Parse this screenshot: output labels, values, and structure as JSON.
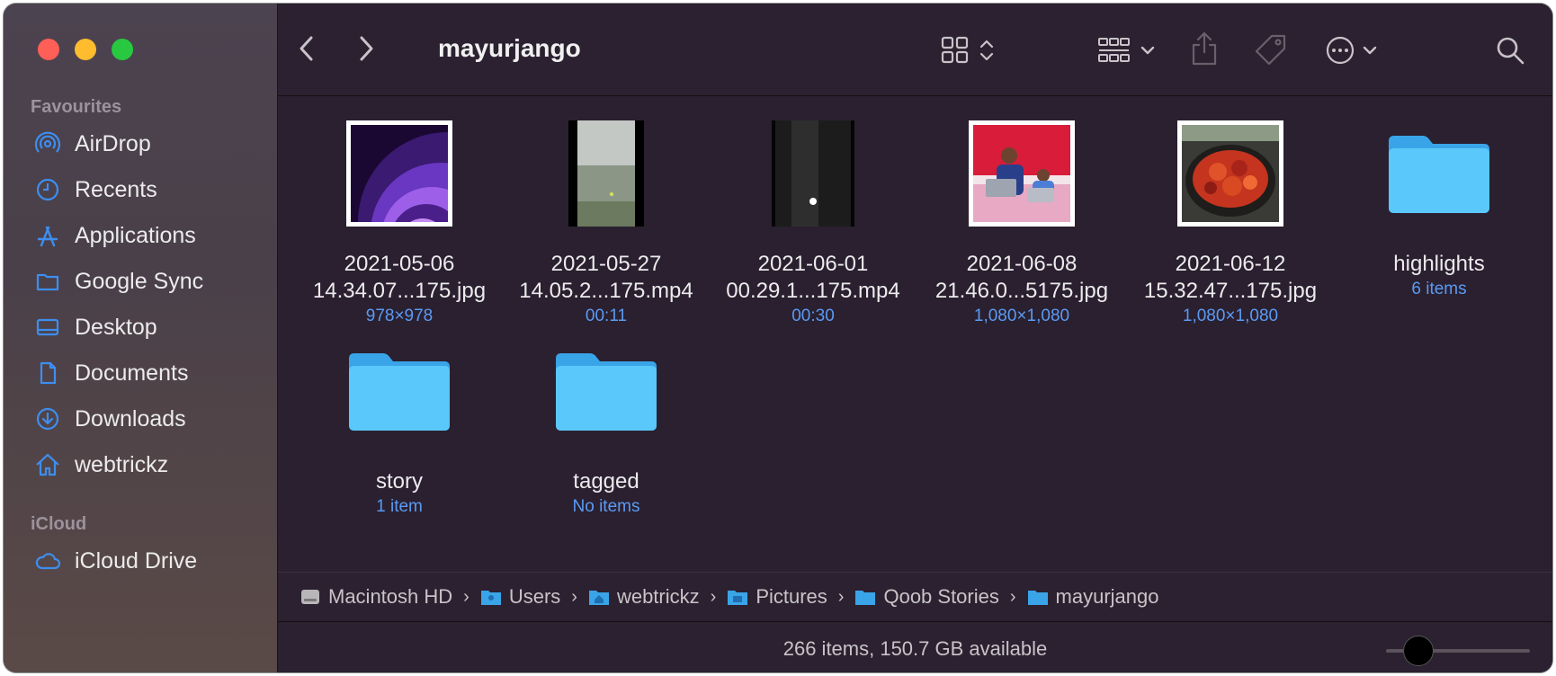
{
  "window": {
    "title": "mayurjango"
  },
  "sidebar": {
    "sections": [
      {
        "label": "Favourites"
      },
      {
        "label": "iCloud"
      }
    ],
    "favourites": [
      {
        "label": "AirDrop",
        "icon": "airdrop-icon"
      },
      {
        "label": "Recents",
        "icon": "clock-icon"
      },
      {
        "label": "Applications",
        "icon": "applications-icon"
      },
      {
        "label": "Google Sync",
        "icon": "folder-icon"
      },
      {
        "label": "Desktop",
        "icon": "desktop-icon"
      },
      {
        "label": "Documents",
        "icon": "document-icon"
      },
      {
        "label": "Downloads",
        "icon": "download-icon"
      },
      {
        "label": "webtrickz",
        "icon": "home-icon"
      }
    ],
    "icloud": [
      {
        "label": "iCloud Drive",
        "icon": "cloud-icon"
      }
    ]
  },
  "files": [
    {
      "name1": "2021-05-06",
      "name2": "14.34.07...175.jpg",
      "meta": "978×978",
      "kind": "image-purple"
    },
    {
      "name1": "2021-05-27",
      "name2": "14.05.2...175.mp4",
      "meta": "00:11",
      "kind": "video-lake"
    },
    {
      "name1": "2021-06-01",
      "name2": "00.29.1...175.mp4",
      "meta": "00:30",
      "kind": "video-dark"
    },
    {
      "name1": "2021-06-08",
      "name2": "21.46.0...5175.jpg",
      "meta": "1,080×1,080",
      "kind": "image-people"
    },
    {
      "name1": "2021-06-12",
      "name2": "15.32.47...175.jpg",
      "meta": "1,080×1,080",
      "kind": "image-food"
    },
    {
      "name1": "highlights",
      "name2": "",
      "meta": "6 items",
      "kind": "folder"
    },
    {
      "name1": "story",
      "name2": "",
      "meta": "1 item",
      "kind": "folder"
    },
    {
      "name1": "tagged",
      "name2": "",
      "meta": "No items",
      "kind": "folder"
    }
  ],
  "pathbar": [
    {
      "label": "Macintosh HD",
      "icon": "harddrive-icon"
    },
    {
      "label": "Users",
      "icon": "folder-users-icon"
    },
    {
      "label": "webtrickz",
      "icon": "folder-home-icon"
    },
    {
      "label": "Pictures",
      "icon": "folder-pictures-icon"
    },
    {
      "label": "Qoob Stories",
      "icon": "folder-icon"
    },
    {
      "label": "mayurjango",
      "icon": "folder-icon"
    }
  ],
  "status": {
    "text": "266 items, 150.7 GB available"
  },
  "colors": {
    "accent": "#5b9af2",
    "folder": "#5ac8fa",
    "window_bg": "#2a2030"
  }
}
